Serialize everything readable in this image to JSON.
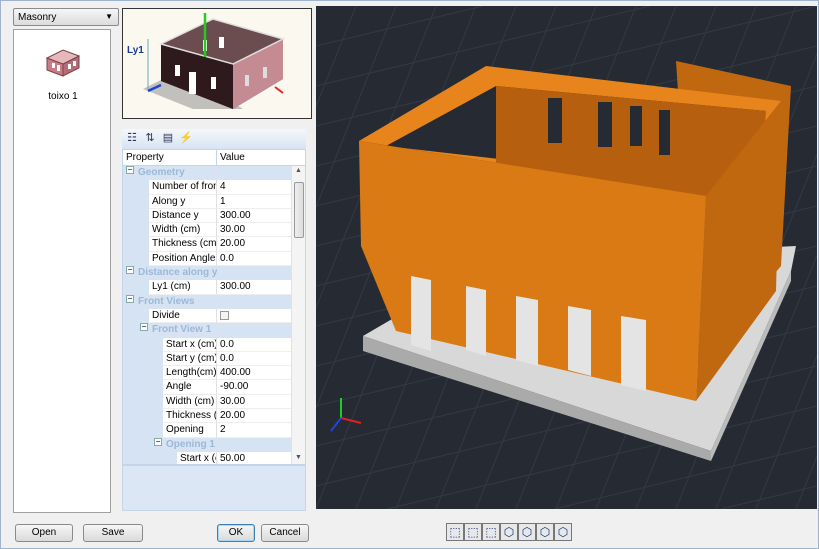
{
  "library": {
    "selected": "Masonry",
    "items": [
      {
        "label": "toixo 1"
      }
    ]
  },
  "preview": {
    "label": "Ly1"
  },
  "property_grid": {
    "toolbar": [
      {
        "icon": "categorized-icon"
      },
      {
        "icon": "sort-alpha-icon"
      },
      {
        "icon": "property-pages-icon"
      },
      {
        "icon": "events-icon"
      }
    ],
    "columns": [
      "Property",
      "Value"
    ],
    "rows": [
      {
        "type": "cat",
        "level": 0,
        "name": "Geometry"
      },
      {
        "level": 1,
        "name": "Number of front ...",
        "value": "4"
      },
      {
        "level": 1,
        "name": "Along y",
        "value": "1"
      },
      {
        "level": 1,
        "name": "Distance y",
        "value": "300.00"
      },
      {
        "level": 1,
        "name": "Width (cm)",
        "value": "30.00"
      },
      {
        "level": 1,
        "name": "Thickness (cm)",
        "value": "20.00"
      },
      {
        "level": 1,
        "name": "Position Angle",
        "value": "0.0"
      },
      {
        "type": "cat",
        "level": 0,
        "name": "Distance along y"
      },
      {
        "level": 1,
        "name": "Ly1 (cm)",
        "value": "300.00"
      },
      {
        "type": "cat",
        "level": 0,
        "name": "Front Views"
      },
      {
        "level": 1,
        "name": "Divide",
        "value": "",
        "checkbox": true,
        "checked": false
      },
      {
        "type": "cat",
        "level": 1,
        "name": "Front View 1"
      },
      {
        "level": 2,
        "name": "Start x (cm)",
        "value": "0.0"
      },
      {
        "level": 2,
        "name": "Start y (cm)",
        "value": "0.0"
      },
      {
        "level": 2,
        "name": "Length(cm)",
        "value": "400.00"
      },
      {
        "level": 2,
        "name": "Angle",
        "value": "-90.00"
      },
      {
        "level": 2,
        "name": "Width (cm)",
        "value": "30.00"
      },
      {
        "level": 2,
        "name": "Thickness (...",
        "value": "20.00"
      },
      {
        "level": 2,
        "name": "Opening",
        "value": "2"
      },
      {
        "type": "cat",
        "level": 2,
        "name": "Opening 1"
      },
      {
        "level": 3,
        "name": "Start x (c...",
        "value": "50.00"
      }
    ]
  },
  "viewport": {
    "background": "#262b33",
    "wall_color": "#d97a14",
    "base_color": "#d8d8d8",
    "axes": [
      "x",
      "y",
      "z"
    ]
  },
  "buttons": {
    "open": "Open",
    "save": "Save",
    "ok": "OK",
    "cancel": "Cancel"
  },
  "view_buttons": [
    "view-iso-1-icon",
    "view-iso-2-icon",
    "view-iso-3-icon",
    "view-front-icon",
    "view-back-icon",
    "view-left-icon",
    "view-right-icon"
  ]
}
